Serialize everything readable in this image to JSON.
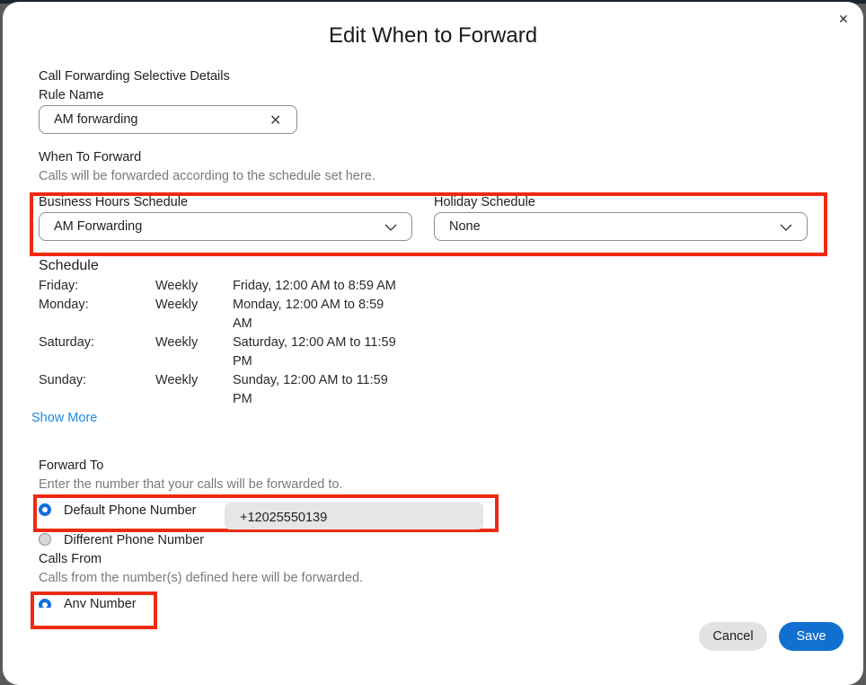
{
  "dialog": {
    "title": "Edit When to Forward",
    "close_icon": "close-icon"
  },
  "details": {
    "section_title": "Call Forwarding Selective Details",
    "rule_name_label": "Rule Name",
    "rule_name_value": "AM forwarding",
    "clear_icon": "clear-icon"
  },
  "when_to_forward": {
    "title": "When To Forward",
    "description": "Calls will be forwarded according to the schedule set here.",
    "business_hours_label": "Business Hours Schedule",
    "business_hours_value": "AM Forwarding",
    "holiday_label": "Holiday Schedule",
    "holiday_value": "None"
  },
  "schedule": {
    "title": "Schedule",
    "rows": [
      {
        "day": "Friday:",
        "recurrence": "Weekly",
        "time": "Friday, 12:00 AM to 8:59 AM"
      },
      {
        "day": "Monday:",
        "recurrence": "Weekly",
        "time": "Monday, 12:00 AM to 8:59 AM"
      },
      {
        "day": "Saturday:",
        "recurrence": "Weekly",
        "time": "Saturday, 12:00 AM to 11:59 PM"
      },
      {
        "day": "Sunday:",
        "recurrence": "Weekly",
        "time": "Sunday, 12:00 AM to 11:59 PM"
      }
    ],
    "show_more": "Show More"
  },
  "forward_to": {
    "title": "Forward To",
    "description": "Enter the number that your calls will be forwarded to.",
    "options": [
      {
        "label": "Default Phone Number",
        "selected": true
      },
      {
        "label": "Different Phone Number",
        "selected": false
      }
    ],
    "default_number": "+12025550139"
  },
  "calls_from": {
    "title": "Calls From",
    "description": "Calls from the number(s) defined here will be forwarded.",
    "options": [
      {
        "label": "Any Number",
        "selected": true
      }
    ]
  },
  "footer": {
    "cancel_label": "Cancel",
    "save_label": "Save"
  },
  "colors": {
    "accent": "#1170cf",
    "highlight": "#ee2a12",
    "link": "#1d8ae0"
  }
}
